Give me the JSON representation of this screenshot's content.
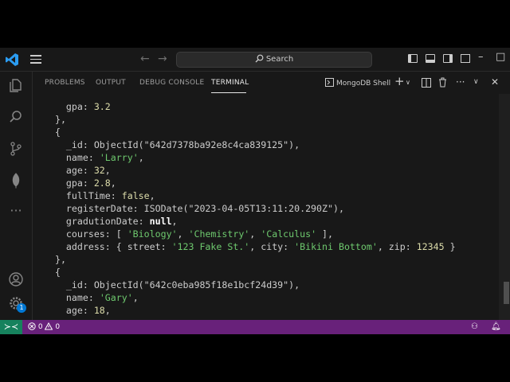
{
  "titlebar": {
    "search_label": "Search"
  },
  "panel": {
    "tabs": [
      {
        "label": "PROBLEMS",
        "active": false
      },
      {
        "label": "OUTPUT",
        "active": false
      },
      {
        "label": "DEBUG CONSOLE",
        "active": false
      },
      {
        "label": "TERMINAL",
        "active": true
      }
    ],
    "shell_label": "MongoDB Shell"
  },
  "terminal": {
    "lines": [
      "gpa_32",
      "close1",
      "open2",
      "id_larry",
      "name_larry",
      "age_larry",
      "gpa_larry",
      "fulltime_larry",
      "register_larry",
      "grad_larry",
      "courses_larry",
      "address_larry",
      "close2",
      "open3",
      "id_gary",
      "name_gary",
      "age_gary"
    ],
    "records": {
      "prev_gpa": "3.2",
      "larry": {
        "id": "642d7378ba92e8c4ca839125",
        "name": "'Larry'",
        "age": "32",
        "gpa": "2.8",
        "fullTime": "false",
        "registerDate": "2023-04-05T13:11:20.290Z",
        "gradutionDate": "null",
        "courses": [
          "'Biology'",
          "'Chemistry'",
          "'Calculus'"
        ],
        "street": "'123 Fake St.'",
        "city": "'Bikini Bottom'",
        "zip": "12345"
      },
      "gary": {
        "id": "642c0eba985f18e1bcf24d39",
        "name": "'Gary'",
        "age": "18"
      }
    }
  },
  "status": {
    "errors": "0",
    "warnings": "0",
    "badge": "1"
  },
  "colors": {
    "status_bar": "#68217a",
    "remote": "#16825d",
    "string": "#6ec96e",
    "number": "#dcdcaa",
    "accent": "#0078d4"
  }
}
